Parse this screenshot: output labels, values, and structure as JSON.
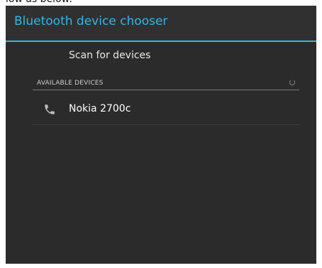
{
  "caption": "low as below:",
  "dialog": {
    "title": "Bluetooth device chooser",
    "scan_label": "Scan for devices",
    "section_header": "AVAILABLE DEVICES",
    "section_icon": "progress-spinner-icon",
    "devices": [
      {
        "icon": "phone-icon",
        "name": "Nokia 2700c"
      }
    ]
  },
  "colors": {
    "accent": "#33b5e5",
    "background": "#2b2b2b",
    "title_bar": "#303030",
    "text": "#ffffff"
  }
}
